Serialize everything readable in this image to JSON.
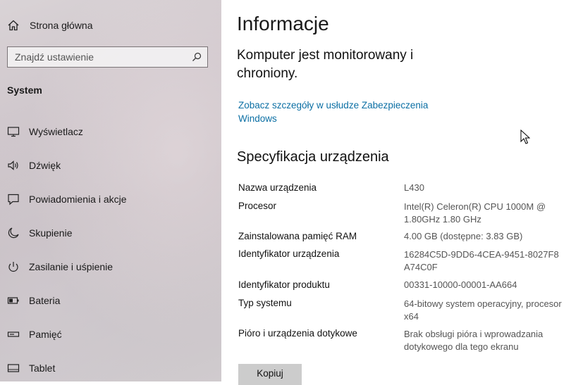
{
  "sidebar": {
    "home_label": "Strona główna",
    "search_placeholder": "Znajdź ustawienie",
    "section_title": "System",
    "items": [
      {
        "label": "Wyświetlacz",
        "icon": "monitor-icon"
      },
      {
        "label": "Dźwięk",
        "icon": "speaker-icon"
      },
      {
        "label": "Powiadomienia i akcje",
        "icon": "notification-icon"
      },
      {
        "label": "Skupienie",
        "icon": "moon-icon"
      },
      {
        "label": "Zasilanie i uśpienie",
        "icon": "power-icon"
      },
      {
        "label": "Bateria",
        "icon": "battery-icon"
      },
      {
        "label": "Pamięć",
        "icon": "storage-icon"
      },
      {
        "label": "Tablet",
        "icon": "tablet-icon"
      }
    ]
  },
  "main": {
    "title": "Informacje",
    "status": "Komputer jest monitorowany i chroniony.",
    "security_link": "Zobacz szczegóły w usłudze Zabezpieczenia Windows",
    "spec_heading": "Specyfikacja urządzenia",
    "specs": [
      {
        "key": "Nazwa urządzenia",
        "value": "L430"
      },
      {
        "key": "Procesor",
        "value": "Intel(R) Celeron(R) CPU 1000M @ 1.80GHz   1.80 GHz"
      },
      {
        "key": "Zainstalowana pamięć RAM",
        "value": "4.00 GB (dostępne: 3.83 GB)"
      },
      {
        "key": "Identyfikator urządzenia",
        "value": "16284C5D-9DD6-4CEA-9451-8027F8A74C0F"
      },
      {
        "key": "Identyfikator produktu",
        "value": "00331-10000-00001-AA664"
      },
      {
        "key": "Typ systemu",
        "value": "64-bitowy system operacyjny, procesor x64"
      },
      {
        "key": "Pióro i urządzenia dotykowe",
        "value": "Brak obsługi pióra i wprowadzania dotykowego dla tego ekranu"
      }
    ],
    "copy_button": "Kopiuj"
  },
  "colors": {
    "link": "#0b6fa4",
    "button_bg": "#cccccc"
  }
}
